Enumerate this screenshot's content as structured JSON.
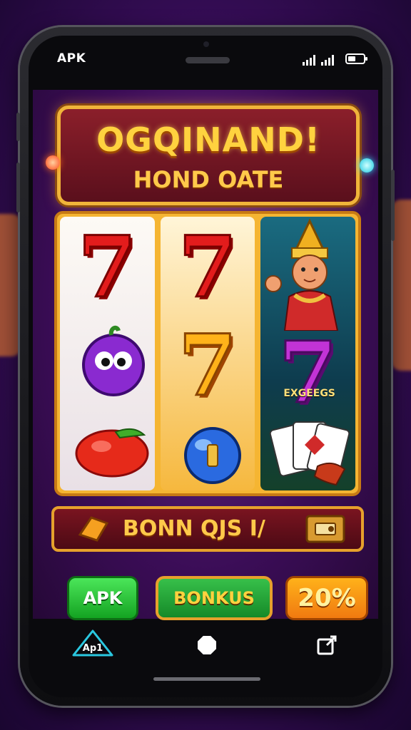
{
  "status_bar": {
    "label": "APK"
  },
  "banner": {
    "title": "OGQINAND!",
    "subtitle": "HOND OATE"
  },
  "reels": {
    "symbol_seven": "7",
    "reel3_label": "EXGEEGS"
  },
  "bonus_bar": {
    "text": "BONN QJS I/"
  },
  "buttons": {
    "apk": "APK",
    "bonus": "BONKUS",
    "percent": "20%"
  },
  "navbar": {
    "left_icon_label": "Ap1"
  },
  "colors": {
    "banner_gold": "#ffd23f",
    "banner_red": "#8b1f2a",
    "apk_green": "#14a322",
    "bonus_orange": "#f07a10",
    "background_purple": "#3a0e5c"
  }
}
